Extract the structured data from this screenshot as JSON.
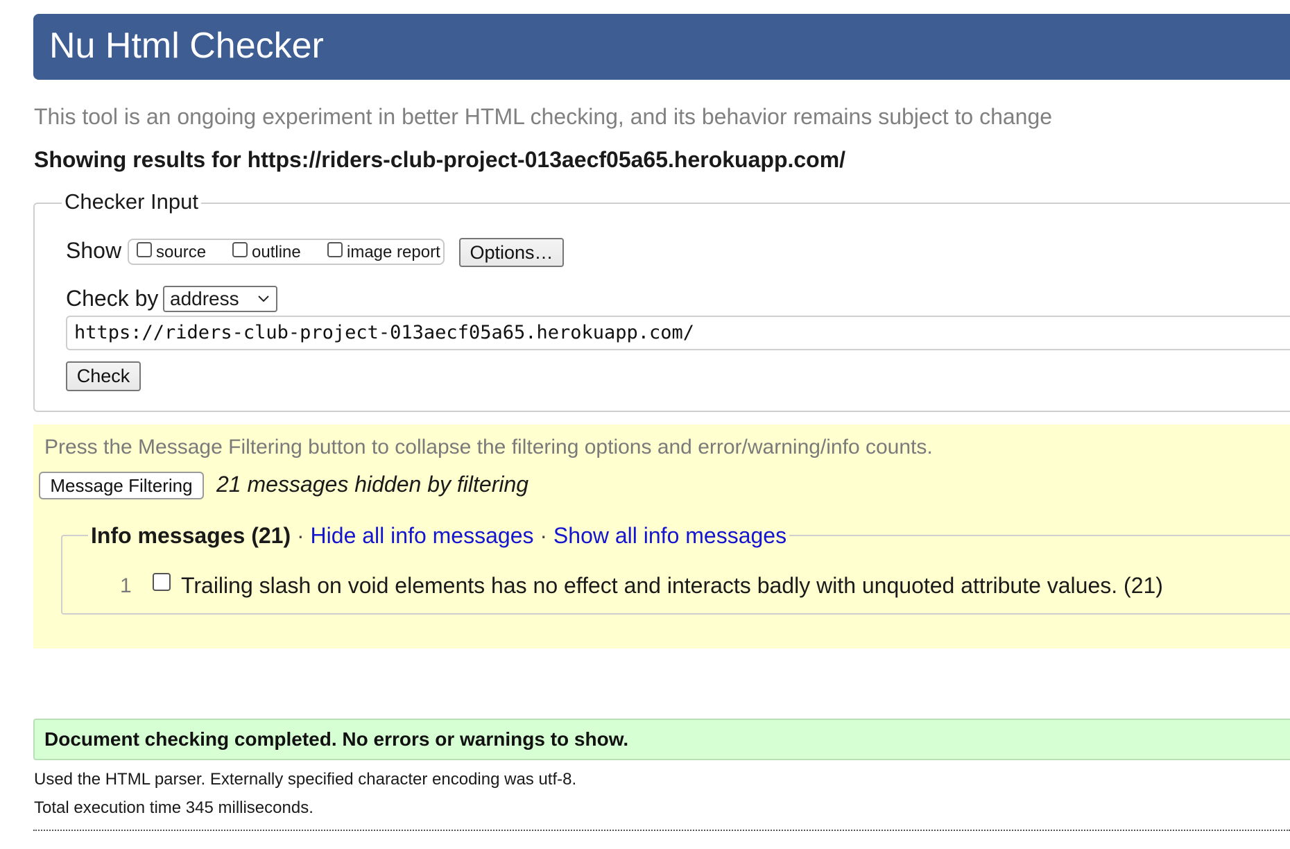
{
  "header": {
    "title": "Nu Html Checker"
  },
  "subtitle": "This tool is an ongoing experiment in better HTML checking, and its behavior remains subject to change",
  "results_heading": "Showing results for https://riders-club-project-013aecf05a65.herokuapp.com/",
  "checker_input": {
    "legend": "Checker Input",
    "show_label": "Show",
    "show_options": [
      {
        "label": "source",
        "checked": false
      },
      {
        "label": "outline",
        "checked": false
      },
      {
        "label": "image report",
        "checked": false
      }
    ],
    "options_button": "Options…",
    "check_by_label": "Check by",
    "check_by_value": "address",
    "url_value": "https://riders-club-project-013aecf05a65.herokuapp.com/",
    "check_button": "Check"
  },
  "filtering": {
    "note": "Press the Message Filtering button to collapse the filtering options and error/warning/info counts.",
    "button_label": "Message Filtering",
    "hidden_summary": "21 messages hidden by filtering",
    "info_group": {
      "title": "Info messages (21)",
      "separator": "·",
      "hide_link": "Hide all info messages",
      "show_link": "Show all info messages",
      "messages": [
        {
          "number": "1",
          "checked": false,
          "text": "Trailing slash on void elements has no effect and interacts badly with unquoted attribute values. (21)"
        }
      ]
    }
  },
  "result": {
    "summary": "Document checking completed. No errors or warnings to show.",
    "parser_note": "Used the HTML parser. Externally specified character encoding was utf-8.",
    "execution_time": "Total execution time 345 milliseconds."
  },
  "colors": {
    "banner": "#3e5d92",
    "filter_background": "#ffffcf",
    "success_background": "#d7ffd4",
    "link": "#1515d0"
  }
}
